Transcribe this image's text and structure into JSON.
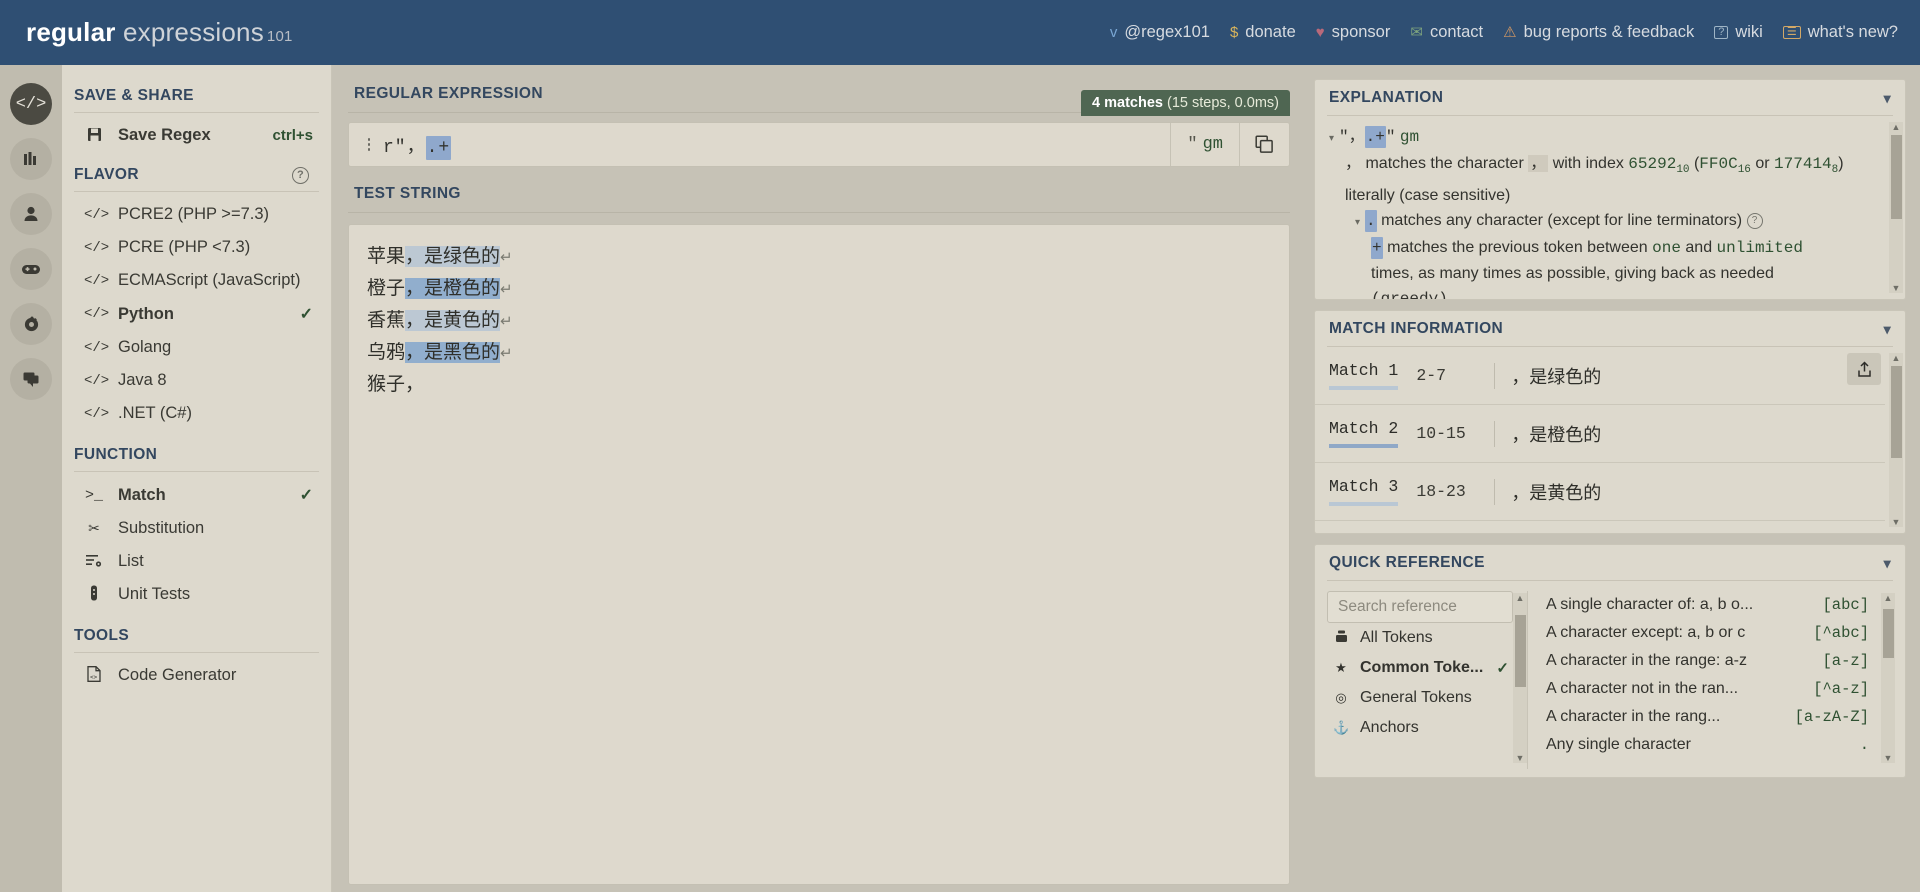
{
  "header": {
    "logo_bold": "regular",
    "logo_light": "expressions",
    "logo_sup": "101",
    "links": [
      {
        "icon": "twitter-icon",
        "glyph": "ᴠ",
        "label": "@regex101",
        "color": "#7aa7d4"
      },
      {
        "icon": "dollar-icon",
        "glyph": "$",
        "label": "donate",
        "color": "#d8b45c"
      },
      {
        "icon": "heart-icon",
        "glyph": "♥",
        "label": "sponsor",
        "color": "#b9697a"
      },
      {
        "icon": "mail-icon",
        "glyph": "✉",
        "label": "contact",
        "color": "#7da37e"
      },
      {
        "icon": "warning-icon",
        "glyph": "⚠",
        "label": "bug reports & feedback",
        "color": "#d79a63"
      },
      {
        "icon": "question-box-icon",
        "glyph": "?",
        "label": "wiki",
        "color": "#9fb5c6"
      },
      {
        "icon": "news-icon",
        "glyph": "☰",
        "label": "what's new?",
        "color": "#d2a867"
      }
    ]
  },
  "rail": [
    {
      "name": "code-icon",
      "glyph": "</>",
      "active": true
    },
    {
      "name": "library-icon",
      "glyph": "‖",
      "active": false
    },
    {
      "name": "account-icon",
      "glyph": "●",
      "active": false
    },
    {
      "name": "gamepad-icon",
      "glyph": "▬",
      "active": false
    },
    {
      "name": "gear-icon",
      "glyph": "⚙",
      "active": false
    },
    {
      "name": "chat-icon",
      "glyph": "▣",
      "active": false
    }
  ],
  "sidebar": {
    "save_share": {
      "title": "SAVE & SHARE",
      "items": [
        {
          "icon": "floppy-icon",
          "glyph": "▤",
          "label": "Save Regex",
          "shortcut": "ctrl+s",
          "bold": true
        }
      ]
    },
    "flavor": {
      "title": "FLAVOR",
      "help": "?",
      "items": [
        {
          "icon": "code-icon",
          "glyph": "</>",
          "label": "PCRE2 (PHP >=7.3)",
          "selected": false
        },
        {
          "icon": "code-icon",
          "glyph": "</>",
          "label": "PCRE (PHP <7.3)",
          "selected": false
        },
        {
          "icon": "code-icon",
          "glyph": "</>",
          "label": "ECMAScript (JavaScript)",
          "selected": false
        },
        {
          "icon": "code-icon",
          "glyph": "</>",
          "label": "Python",
          "selected": true
        },
        {
          "icon": "code-icon",
          "glyph": "</>",
          "label": "Golang",
          "selected": false
        },
        {
          "icon": "code-icon",
          "glyph": "</>",
          "label": "Java 8",
          "selected": false
        },
        {
          "icon": "code-icon",
          "glyph": "</>",
          "label": ".NET (C#)",
          "selected": false
        }
      ]
    },
    "function": {
      "title": "FUNCTION",
      "items": [
        {
          "icon": "terminal-icon",
          "glyph": ">_",
          "label": "Match",
          "selected": true
        },
        {
          "icon": "scissors-icon",
          "glyph": "✂",
          "label": "Substitution",
          "selected": false
        },
        {
          "icon": "list-icon",
          "glyph": "≡",
          "label": "List",
          "selected": false
        },
        {
          "icon": "test-tube-icon",
          "glyph": "⚗",
          "label": "Unit Tests",
          "selected": false
        }
      ]
    },
    "tools": {
      "title": "TOOLS",
      "items": [
        {
          "icon": "file-code-icon",
          "glyph": "☷",
          "label": "Code Generator",
          "selected": false
        }
      ]
    }
  },
  "regex_panel": {
    "title": "REGULAR EXPRESSION",
    "badge_count": "4 matches",
    "badge_detail": "(15 steps, 0.0ms)",
    "prefix": "r\"，",
    "highlight": ".+",
    "quote": "\"",
    "flags": "gm",
    "copy_icon": "copy-icon"
  },
  "test_panel": {
    "title": "TEST STRING",
    "lines": [
      {
        "plain": "苹果",
        "match": "，是绿色的",
        "shade": "a",
        "newline": "↵"
      },
      {
        "plain": "橙子",
        "match": "，是橙色的",
        "shade": "b",
        "newline": "↵"
      },
      {
        "plain": "香蕉",
        "match": "，是黄色的",
        "shade": "a",
        "newline": "↵"
      },
      {
        "plain": "乌鸦",
        "match": "，是黑色的",
        "shade": "b",
        "newline": "↵"
      },
      {
        "plain": "猴子，",
        "match": "",
        "shade": "",
        "newline": ""
      }
    ]
  },
  "explanation": {
    "title": "EXPLANATION",
    "pattern_quote": "\"",
    "pattern_comma": "，",
    "pattern_hl": ".+",
    "pattern_flags": "gm",
    "line1_a": "，",
    "line1_b": "matches the character",
    "line1_char": "，",
    "line1_c": "with index",
    "line1_index_dec": "65292",
    "line1_sub_dec": "10",
    "line1_hex_open": "(",
    "line1_hex": "FF0C",
    "line1_sub_hex": "16",
    "line1_or": "or",
    "line1_oct": "177414",
    "line1_sub_oct": "8",
    "line1_tail": ") literally (case sensitive)",
    "line2_tok": ".",
    "line2_text": "matches any character (except for line terminators)",
    "line3_tok": "+",
    "line3_text": "matches the previous token between",
    "line3_one": "one",
    "line3_and": "and",
    "line3_unlimited": "unlimited",
    "line4_text": "times, as many times as possible, giving back as needed",
    "line5_text": "(greedy)"
  },
  "match_info": {
    "title": "MATCH INFORMATION",
    "share_icon": "share-icon",
    "rows": [
      {
        "name": "Match 1",
        "range": "2-7",
        "value": "，是绿色的",
        "shade": "light"
      },
      {
        "name": "Match 2",
        "range": "10-15",
        "value": "，是橙色的",
        "shade": "dark"
      },
      {
        "name": "Match 3",
        "range": "18-23",
        "value": "，是黄色的",
        "shade": "light"
      }
    ]
  },
  "quick_reference": {
    "title": "QUICK REFERENCE",
    "search_placeholder": "Search reference",
    "categories": [
      {
        "icon": "tokens-icon",
        "glyph": "▬",
        "label": "All Tokens",
        "selected": false
      },
      {
        "icon": "star-icon",
        "glyph": "★",
        "label": "Common Toke...",
        "selected": true
      },
      {
        "icon": "target-icon",
        "glyph": "◉",
        "label": "General Tokens",
        "selected": false
      },
      {
        "icon": "anchor-icon",
        "glyph": "⚓",
        "label": "Anchors",
        "selected": false
      }
    ],
    "entries": [
      {
        "desc": "A single character of: a, b o...",
        "token": "[abc]"
      },
      {
        "desc": "A character except: a, b or c",
        "token": "[^abc]"
      },
      {
        "desc": "A character in the range: a-z",
        "token": "[a-z]"
      },
      {
        "desc": "A character not in the ran...",
        "token": "[^a-z]"
      },
      {
        "desc": "A character in the rang...",
        "token": "[a-zA-Z]"
      },
      {
        "desc": "Any single character",
        "token": "."
      }
    ]
  },
  "colors": {
    "topbar": "#2f4f73",
    "page_bg": "#c6c2b6",
    "panel_bg": "#ddd9cd",
    "accent_green": "#2f5132",
    "badge_green": "#4f6652",
    "highlight_blue": "#8fa8cc",
    "highlight_blue_light": "#bcc8d3",
    "heading_blue": "#33475f"
  }
}
